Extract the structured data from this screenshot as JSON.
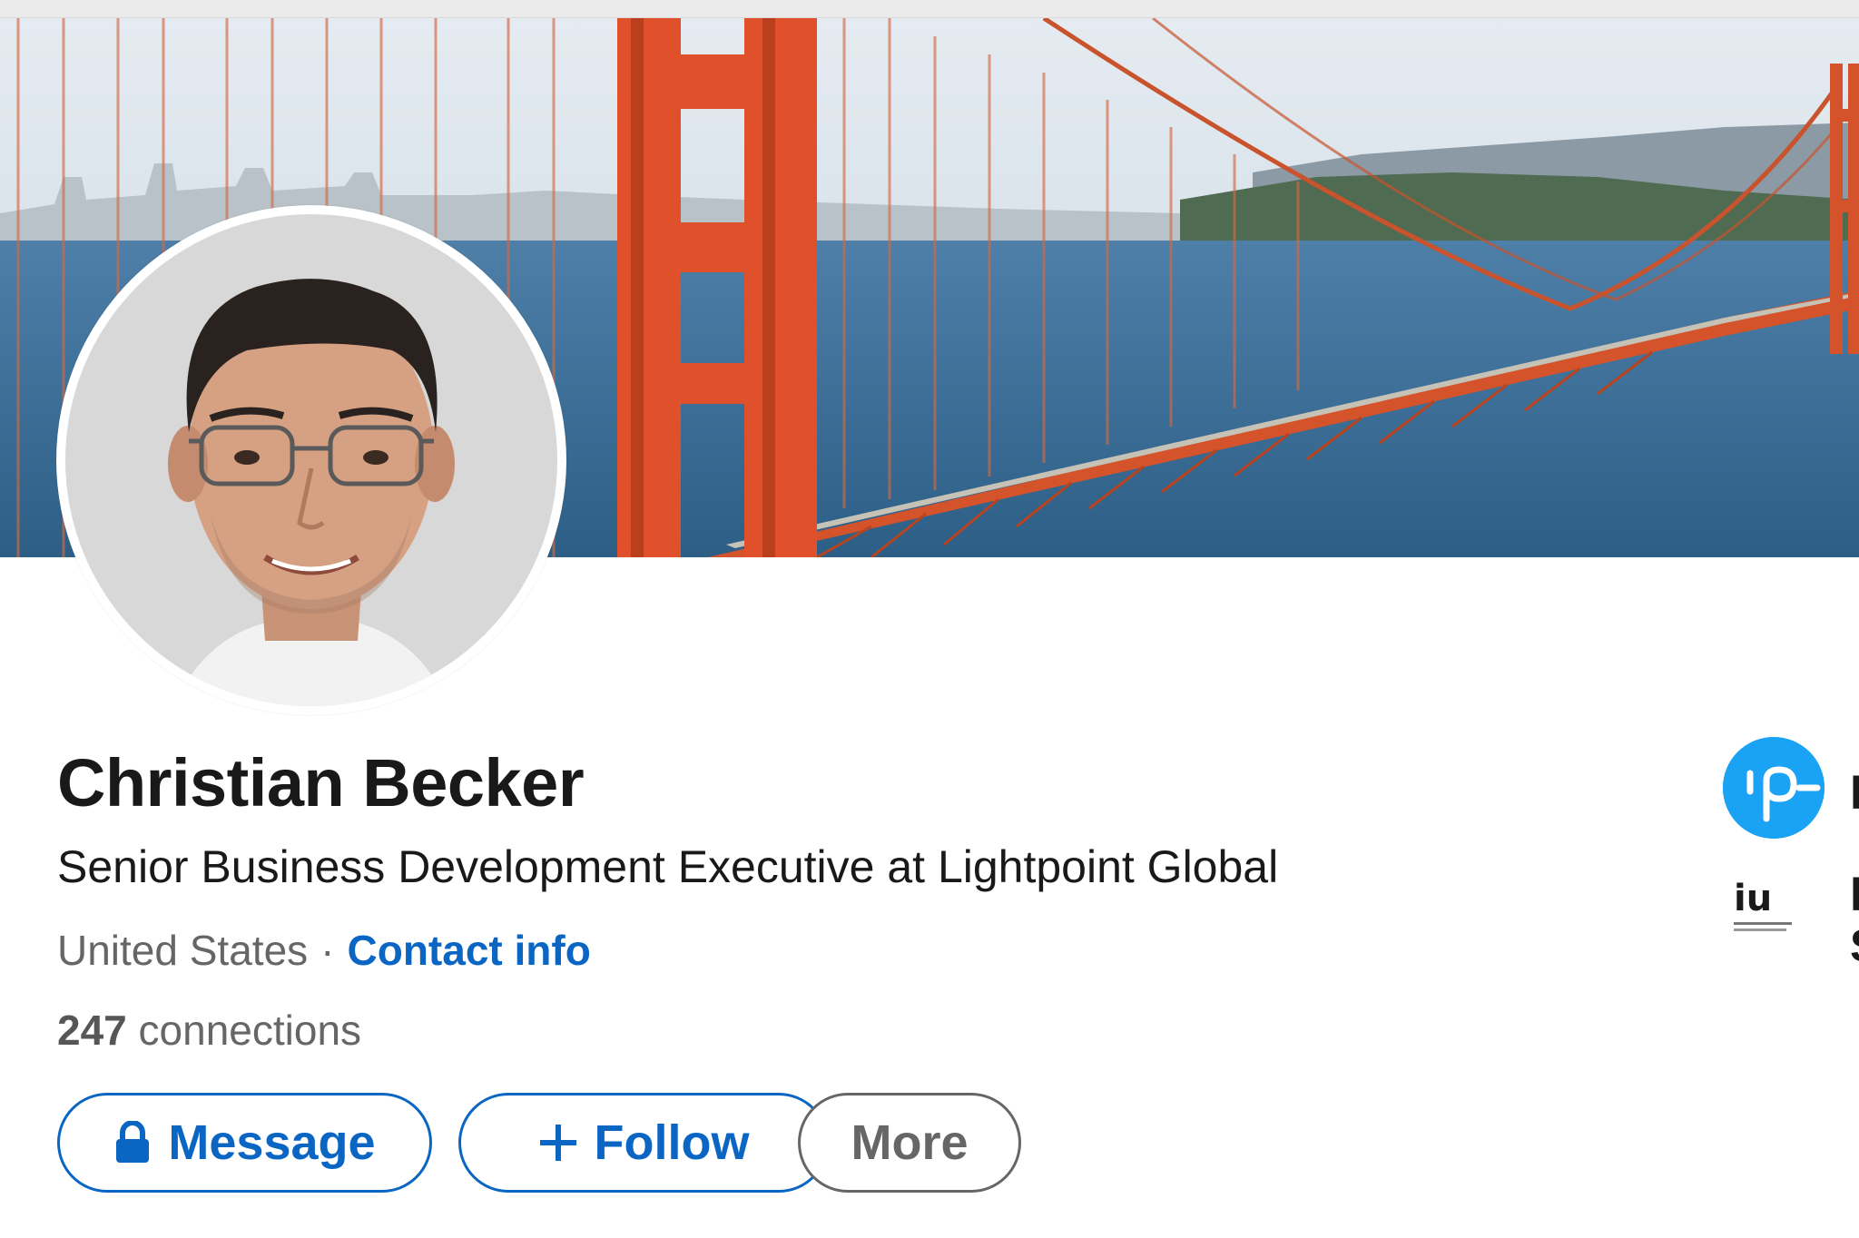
{
  "profile": {
    "name": "Christian Becker",
    "headline": "Senior Business Development Executive at Lightpoint Global",
    "location": "United States",
    "separator": "·",
    "contact_info_label": "Contact info",
    "connections_count": "247",
    "connections_label": "connections"
  },
  "actions": {
    "message_label": "Message",
    "follow_label": "Follow",
    "more_label": "More"
  },
  "icons": {
    "message": "lock-icon",
    "follow": "plus-icon"
  },
  "colors": {
    "accent": "#0a66c2",
    "text_primary": "#191919",
    "text_secondary": "#666666",
    "company_logo": "#1aa3f4"
  },
  "sidebar": {
    "company_logo_text": "ıp",
    "school_logo_text": "iu"
  }
}
